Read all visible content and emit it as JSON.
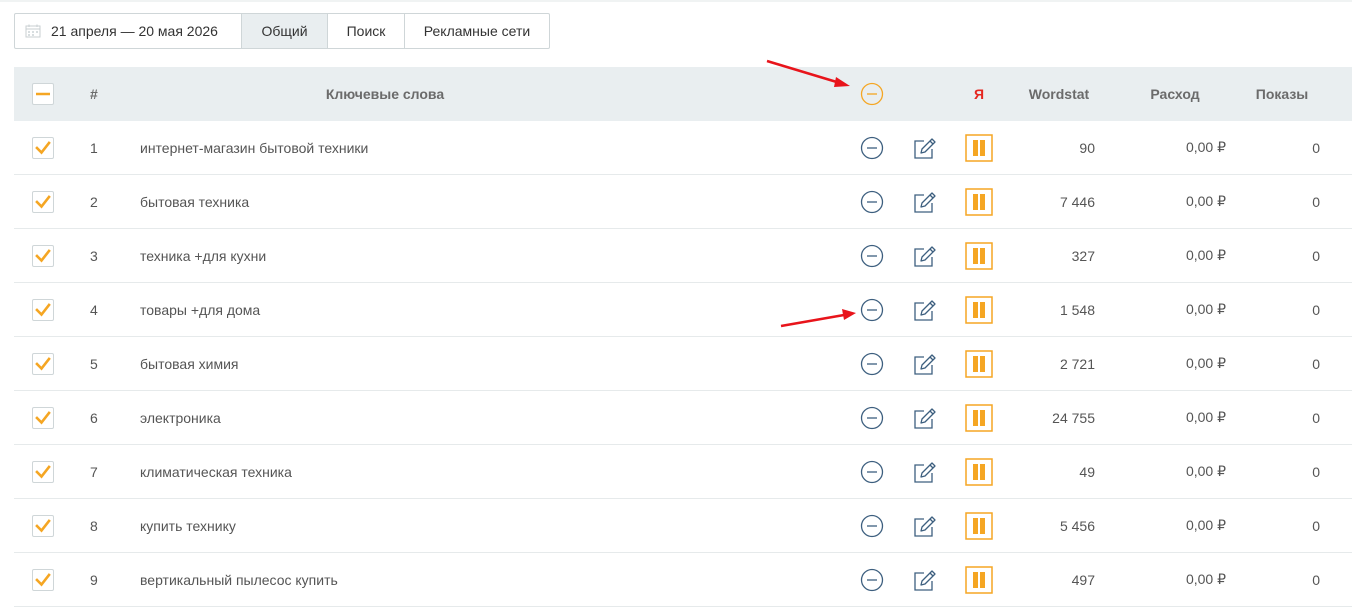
{
  "toolbar": {
    "date_range": "21 апреля — 20 мая 2026",
    "tabs": [
      {
        "label": "Общий",
        "active": true
      },
      {
        "label": "Поиск",
        "active": false
      },
      {
        "label": "Рекламные сети",
        "active": false
      }
    ]
  },
  "table": {
    "headers": {
      "num": "#",
      "keywords": "Ключевые слова",
      "yandex": "Я",
      "wordstat": "Wordstat",
      "cost": "Расход",
      "shows": "Показы"
    },
    "rows": [
      {
        "num": "1",
        "keyword": "интернет-магазин бытовой техники",
        "wordstat": "90",
        "cost": "0,00 ₽",
        "shows": "0",
        "checked": true
      },
      {
        "num": "2",
        "keyword": "бытовая техника",
        "wordstat": "7 446",
        "cost": "0,00 ₽",
        "shows": "0",
        "checked": true
      },
      {
        "num": "3",
        "keyword": "техника +для кухни",
        "wordstat": "327",
        "cost": "0,00 ₽",
        "shows": "0",
        "checked": true
      },
      {
        "num": "4",
        "keyword": "товары +для дома",
        "wordstat": "1 548",
        "cost": "0,00 ₽",
        "shows": "0",
        "checked": true
      },
      {
        "num": "5",
        "keyword": "бытовая химия",
        "wordstat": "2 721",
        "cost": "0,00 ₽",
        "shows": "0",
        "checked": true
      },
      {
        "num": "6",
        "keyword": "электроника",
        "wordstat": "24 755",
        "cost": "0,00 ₽",
        "shows": "0",
        "checked": true
      },
      {
        "num": "7",
        "keyword": "климатическая техника",
        "wordstat": "49",
        "cost": "0,00 ₽",
        "shows": "0",
        "checked": true
      },
      {
        "num": "8",
        "keyword": "купить технику",
        "wordstat": "5 456",
        "cost": "0,00 ₽",
        "shows": "0",
        "checked": true
      },
      {
        "num": "9",
        "keyword": "вертикальный пылесос купить",
        "wordstat": "497",
        "cost": "0,00 ₽",
        "shows": "0",
        "checked": true
      }
    ]
  },
  "icons": {
    "calendar": "calendar-icon",
    "minus": "minus-circle-icon",
    "edit": "edit-icon",
    "pause": "pause-icon",
    "check": "check-icon",
    "arrow": "red-arrow-annotation"
  },
  "colors": {
    "accent_orange": "#f5a623",
    "icon_blue": "#3d5f7f",
    "yandex_red": "#e52620",
    "arrow_red": "#e8141b",
    "header_bg": "#e9eef0"
  }
}
